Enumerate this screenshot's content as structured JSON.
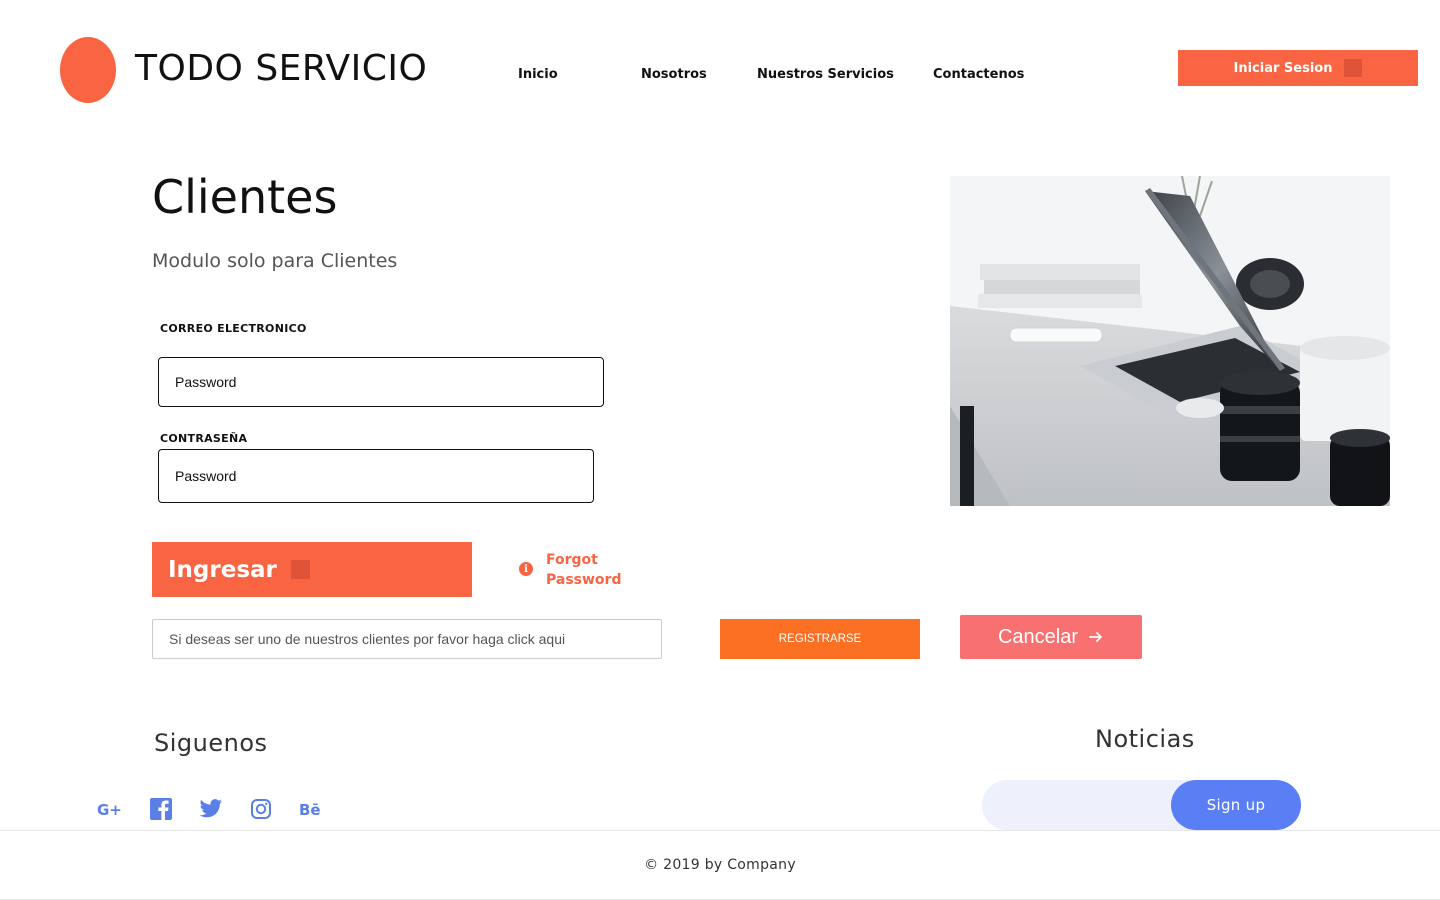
{
  "header": {
    "brand": "TODO SERVICIO",
    "nav": [
      "Inicio",
      "Nosotros",
      "Nuestros Servicios",
      "Contactenos"
    ],
    "login_label": "Iniciar Sesion"
  },
  "main": {
    "title": "Clientes",
    "subtitle": "Modulo solo para Clientes",
    "email_label": "CORREO ELECTRONICO",
    "email_value": "Password",
    "password_label": "CONTRASEÑA",
    "password_value": "Password",
    "submit_label": "Ingresar",
    "forgot_label": "Forgot Password",
    "join_placeholder": "Si deseas ser uno de nuestros clientes por favor haga click aqui",
    "register_label": "REGISTRARSE",
    "cancel_label": "Cancelar"
  },
  "follow": {
    "title": "Siguenos",
    "icons": [
      "google-plus-icon",
      "facebook-icon",
      "twitter-icon",
      "instagram-icon",
      "behance-icon"
    ]
  },
  "news": {
    "title": "Noticias",
    "signup_label": "Sign up"
  },
  "footer": {
    "copyright": "© 2019 by Company"
  },
  "colors": {
    "accent": "#f96443",
    "register": "#fb7022",
    "cancel": "#f97070",
    "social": "#5a7fe6",
    "signup": "#5a7ff5"
  }
}
